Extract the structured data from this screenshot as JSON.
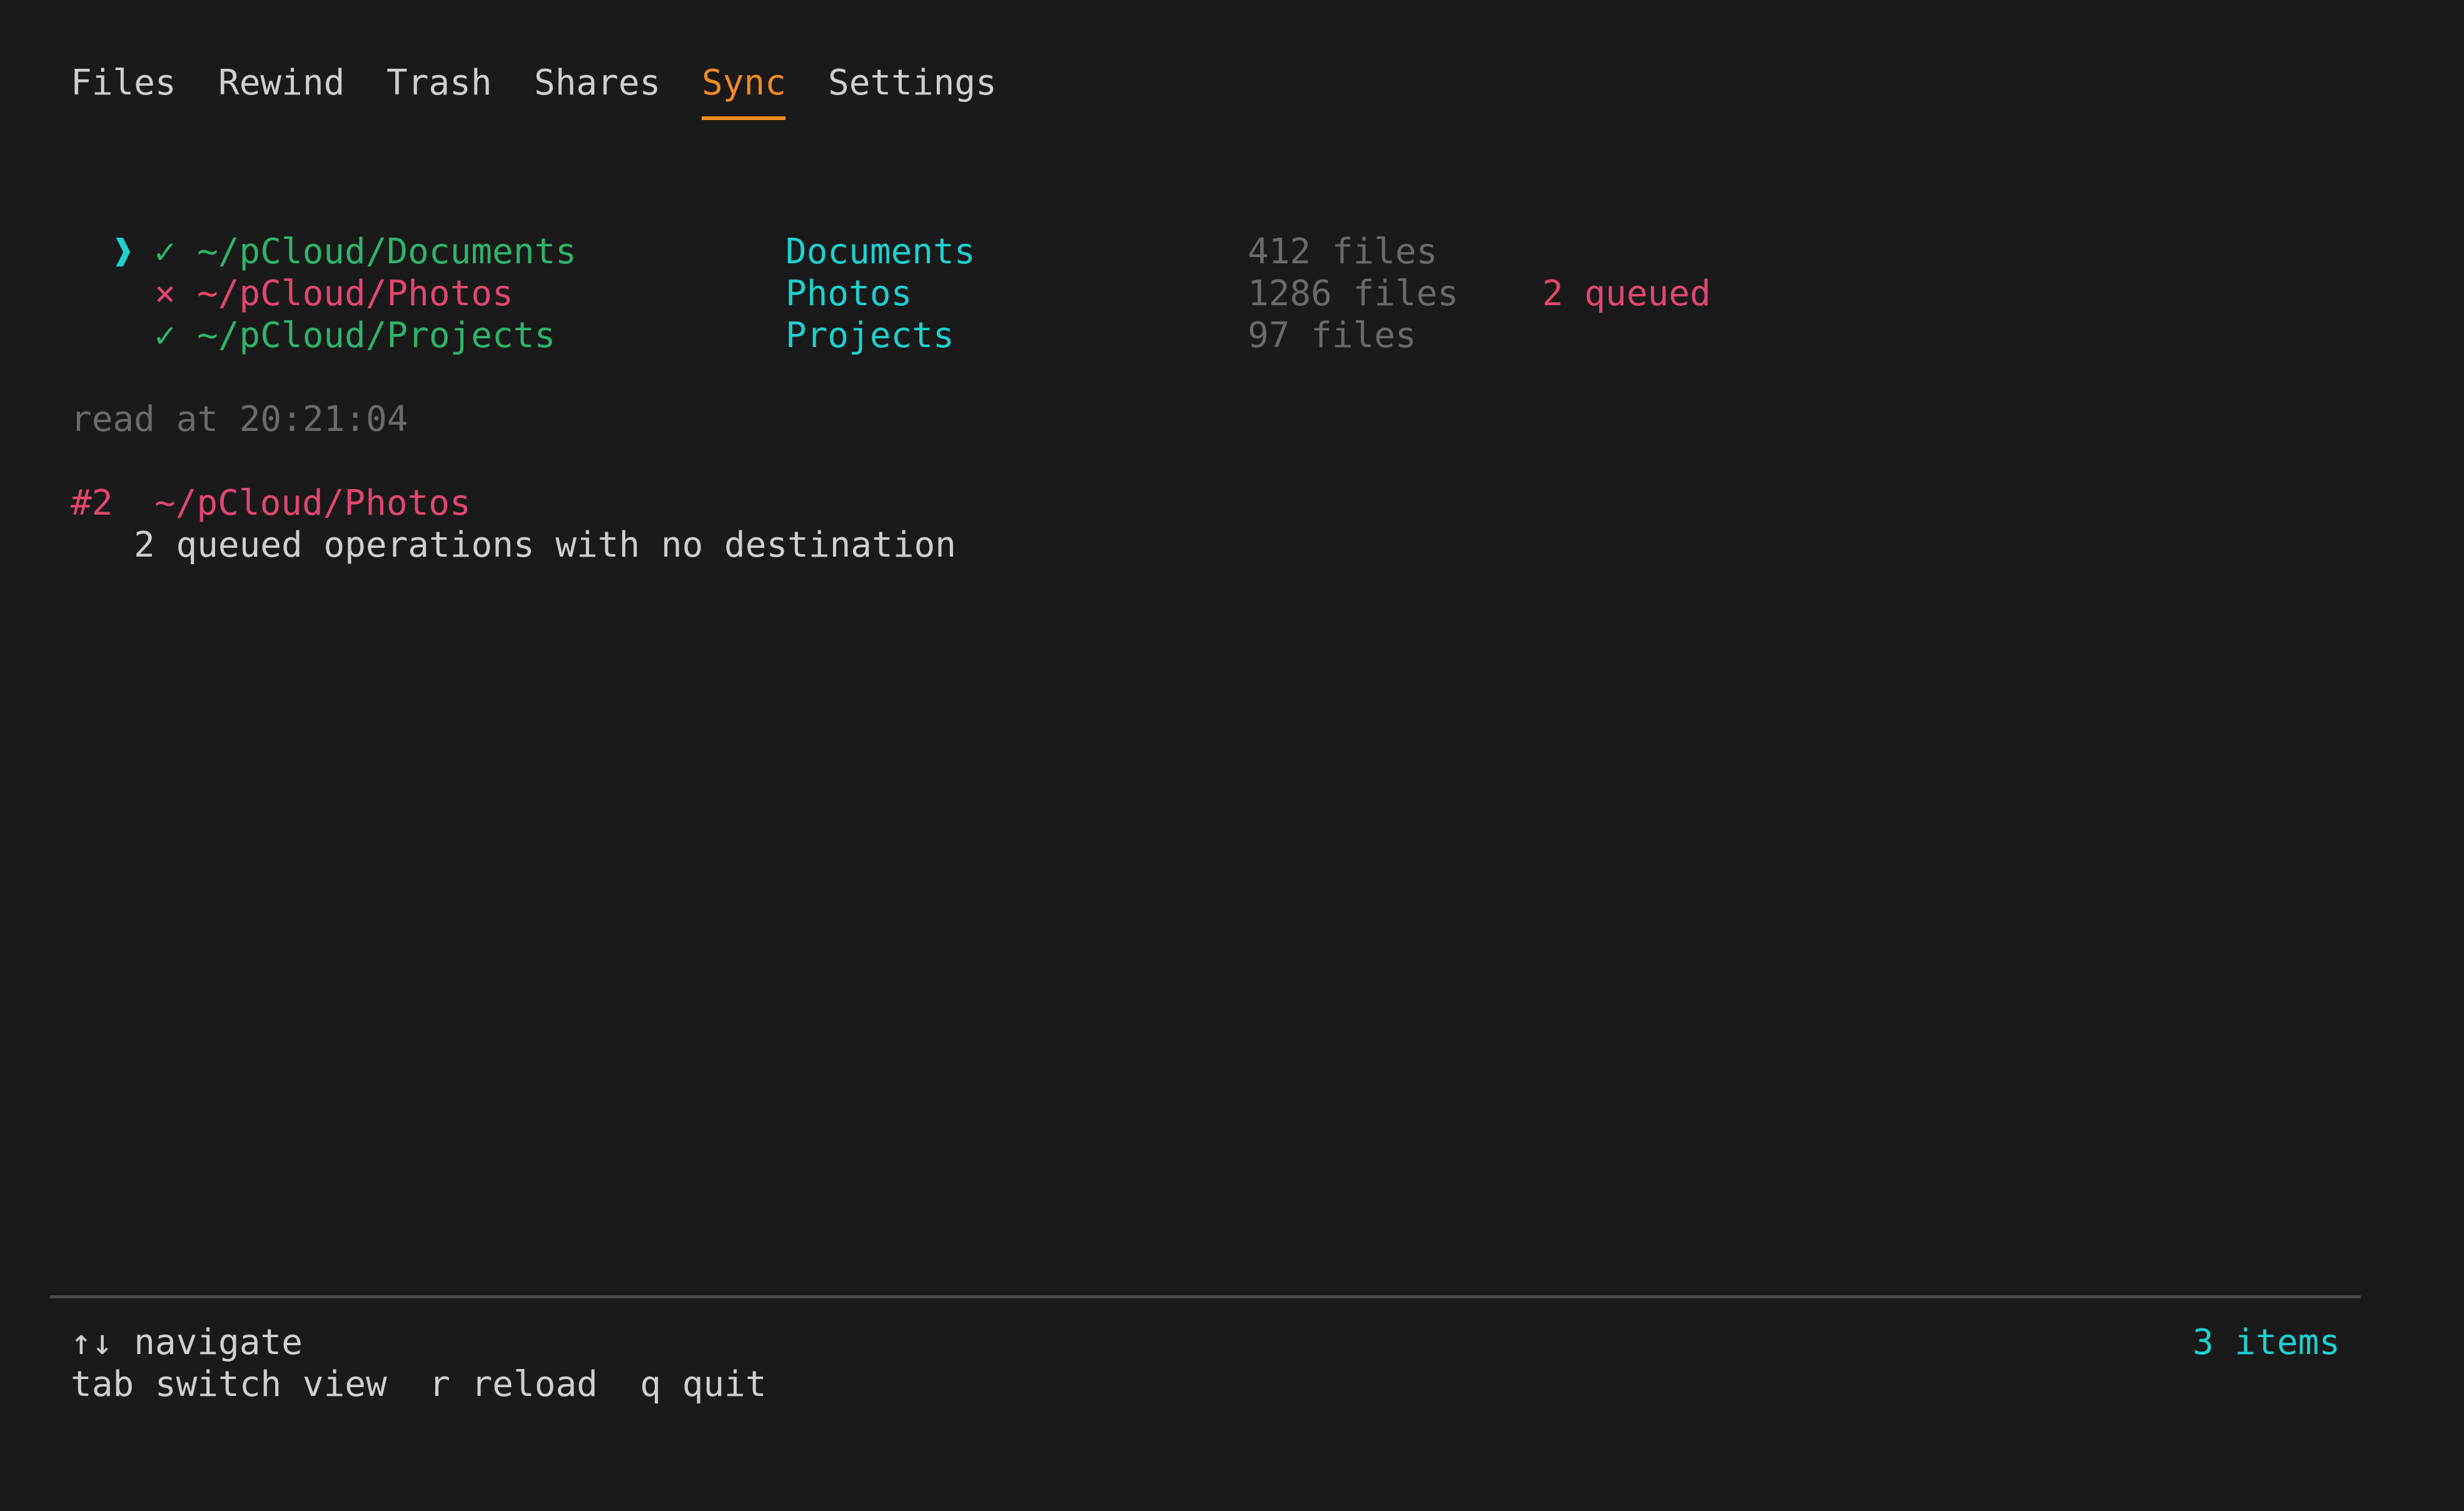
{
  "tabs": [
    {
      "label": "Files",
      "active": false
    },
    {
      "label": "Rewind",
      "active": false
    },
    {
      "label": "Trash",
      "active": false
    },
    {
      "label": "Shares",
      "active": false
    },
    {
      "label": "Sync",
      "active": true
    },
    {
      "label": "Settings",
      "active": false
    }
  ],
  "sync": {
    "rows": [
      {
        "selected": true,
        "status": "ok",
        "status_icon": "✓",
        "local_path": "~/pCloud/Documents",
        "remote": "Documents",
        "files": "412 files",
        "queued": ""
      },
      {
        "selected": false,
        "status": "error",
        "status_icon": "×",
        "local_path": "~/pCloud/Photos",
        "remote": "Photos",
        "files": "1286 files",
        "queued": "2 queued"
      },
      {
        "selected": false,
        "status": "ok",
        "status_icon": "✓",
        "local_path": "~/pCloud/Projects",
        "remote": "Projects",
        "files": "97 files",
        "queued": ""
      }
    ],
    "cursor_glyph": "❱",
    "read_at": "read at 20:21:04"
  },
  "detail": {
    "id": "#2",
    "path": "~/pCloud/Photos",
    "message": "2 queued operations with no destination"
  },
  "footer": {
    "nav_hint": "↑↓ navigate",
    "keys_hint": "tab switch view  r reload  q quit",
    "item_count": "3 items"
  },
  "colors": {
    "background": "#1a1a1a",
    "accent": "#f08a24",
    "ok": "#2fb36b",
    "error": "#e0476f",
    "info": "#1fd0d0",
    "dim": "#6a6a6a"
  }
}
